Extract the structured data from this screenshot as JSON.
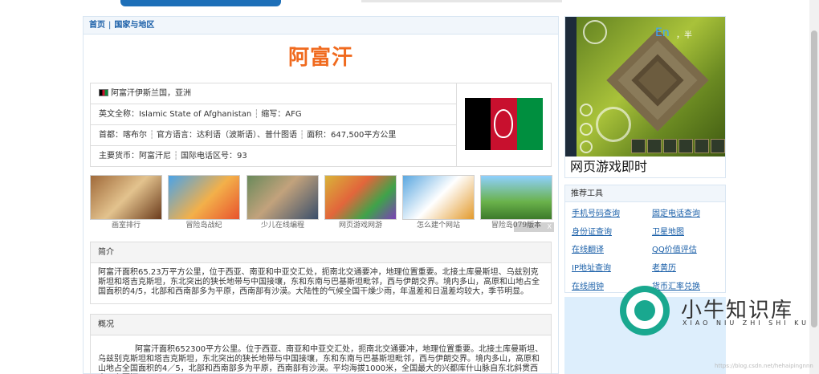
{
  "breadcrumb": {
    "home": "首页",
    "separator": "|",
    "section": "国家与地区"
  },
  "country": {
    "name": "阿富汗",
    "rows": [
      {
        "text": "阿富汗伊斯兰国，亚洲"
      },
      {
        "parts": [
          "英文全称：Islamic State of Afghanistan",
          "缩写：AFG"
        ]
      },
      {
        "parts": [
          "首都：喀布尔",
          "官方语言：达利语（波斯语）、普什图语",
          "面积：647,500平方公里"
        ]
      },
      {
        "parts": [
          "主要货币：阿富汗尼",
          "国际电话区号：93"
        ]
      }
    ],
    "part_separator": "┆"
  },
  "thumbs": [
    {
      "caption": "画室排行"
    },
    {
      "caption": "冒险岛战纪"
    },
    {
      "caption": "少儿在线编程"
    },
    {
      "caption": "网页游戏网游"
    },
    {
      "caption": "怎么建个网站"
    },
    {
      "caption": "冒险岛079版本"
    }
  ],
  "ad_close": "X",
  "sections": {
    "intro": {
      "title": "简介",
      "body": "阿富汗面积65.23万平方公里，位于西亚、南亚和中亚交汇处，扼南北交通要冲，地理位置重要。北接土库曼斯坦、乌兹别克斯坦和塔吉克斯坦，东北突出的狭长地带与中国接壤，东和东南与巴基斯坦毗邻，西与伊朗交界。境内多山，高原和山地占全国面积的4/5，北部和西南部多为平原，西南部有沙漠。大陆性的气候全国干燥少雨，年温差和日温差均较大，季节明显。"
    },
    "overview": {
      "title": "概况",
      "body": "阿富汗面积652300平方公里。位于西亚、南亚和中亚交汇处，扼南北交通要冲，地理位置重要。北接土库曼斯坦、乌兹别克斯坦和塔吉克斯坦，东北突出的狭长地带与中国接壤，东和东南与巴基斯坦毗邻，西与伊朗交界。境内多山，高原和山地占全国面积的4／5，北部和西南部多为平原，西南部有沙漠。平均海拔1000米，全国最大的兴都库什山脉自东北斜贯西南，主要河"
    }
  },
  "ad": {
    "caption": "网页游戏即时",
    "game_lang": "En",
    "game_lang_extra": "，半"
  },
  "tools": {
    "title": "推荐工具",
    "items": [
      "手机号码查询",
      "固定电话查询",
      "身份证查询",
      "卫星地图",
      "在线翻译",
      "QQ价值评估",
      "IP地址查询",
      "老黄历",
      "在线闹钟",
      "货币汇率兑换"
    ]
  },
  "watermark": {
    "title": "小牛知识库",
    "subtitle": "XIAO NIU ZHI SHI KU",
    "blog": "https://blog.csdn.net/hehaipingnnn"
  },
  "colors": {
    "accent": "#f06a1e",
    "link": "#1a5fa8",
    "border": "#d9e6f2"
  }
}
